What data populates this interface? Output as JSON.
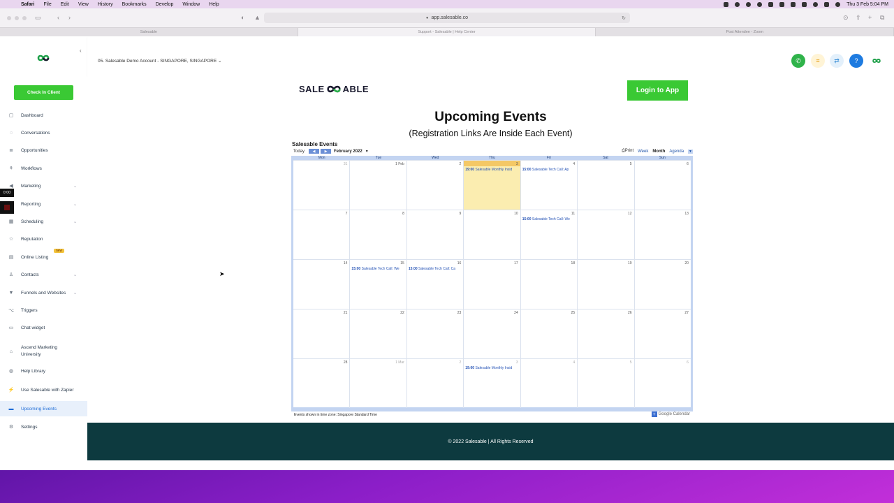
{
  "menubar": {
    "app": "Safari",
    "items": [
      "File",
      "Edit",
      "View",
      "History",
      "Bookmarks",
      "Develop",
      "Window",
      "Help"
    ],
    "clock": "Thu 3 Feb  5:04 PM"
  },
  "browser": {
    "url": "app.salesable.co",
    "tabs": [
      "Salesable",
      "Support - Salesable | Help Center",
      "Post Attendee - Zoom"
    ]
  },
  "sidebar": {
    "checkin_label": "Check In Client",
    "new_badge": "new",
    "recording_time": "0:00",
    "items": [
      {
        "label": "Dashboard",
        "icon": "dashboard-icon",
        "chev": false
      },
      {
        "label": "Conversations",
        "icon": "chat-bubble-icon",
        "chev": false
      },
      {
        "label": "Opportunities",
        "icon": "list-icon",
        "chev": false
      },
      {
        "label": "Workflows",
        "icon": "workflow-icon",
        "chev": false
      },
      {
        "label": "Marketing",
        "icon": "megaphone-icon",
        "chev": true
      },
      {
        "label": "Reporting",
        "icon": "chart-icon",
        "chev": true
      },
      {
        "label": "Scheduling",
        "icon": "calendar-icon",
        "chev": true
      },
      {
        "label": "Reputation",
        "icon": "star-icon",
        "chev": false
      },
      {
        "label": "Online Listing",
        "icon": "listing-icon",
        "chev": false
      },
      {
        "label": "Contacts",
        "icon": "person-icon",
        "chev": true
      },
      {
        "label": "Funnels and Websites",
        "icon": "funnel-icon",
        "chev": true
      },
      {
        "label": "Triggers",
        "icon": "trigger-icon",
        "chev": false
      },
      {
        "label": "Chat widget",
        "icon": "chat-widget-icon",
        "chev": false
      },
      {
        "label": "Ascend Marketing University",
        "icon": "university-icon",
        "chev": false
      },
      {
        "label": "Help Library",
        "icon": "help-icon",
        "chev": false
      },
      {
        "label": "Use Salesable with Zapier",
        "icon": "plug-icon",
        "chev": false
      },
      {
        "label": "Upcoming Events",
        "icon": "events-icon",
        "chev": false
      },
      {
        "label": "Settings",
        "icon": "gear-icon",
        "chev": false
      }
    ]
  },
  "topbar": {
    "account": "05. Salesable Demo Account - SINGAPORE, SINGAPORE"
  },
  "page": {
    "brand_left": "SALE",
    "brand_right": "ABLE",
    "login_label": "Login to App",
    "title": "Upcoming Events",
    "subtitle": "(Registration Links Are Inside Each Event)"
  },
  "calendar": {
    "title": "Salesable Events",
    "today_label": "Today",
    "month_label": "February 2022",
    "views": {
      "print": "Print",
      "week": "Week",
      "month": "Month",
      "agenda": "Agenda"
    },
    "dow": [
      "Mon",
      "Tue",
      "Wed",
      "Thu",
      "Fri",
      "Sat",
      "Sun"
    ],
    "weeks": [
      [
        {
          "n": "31",
          "off": true
        },
        {
          "n": "1 Feb"
        },
        {
          "n": "2"
        },
        {
          "n": "3",
          "today": true,
          "ev": {
            "t": "19:00",
            "l": "Salesable Monthly Insid"
          }
        },
        {
          "n": "4",
          "ev": {
            "t": "15:00",
            "l": "Salesable Tech Call: Ap"
          }
        },
        {
          "n": "5"
        },
        {
          "n": "6"
        }
      ],
      [
        {
          "n": "7"
        },
        {
          "n": "8"
        },
        {
          "n": "9"
        },
        {
          "n": "10"
        },
        {
          "n": "11",
          "ev": {
            "t": "15:00",
            "l": "Salesable Tech Call: We"
          }
        },
        {
          "n": "12"
        },
        {
          "n": "13"
        }
      ],
      [
        {
          "n": "14"
        },
        {
          "n": "15",
          "ev": {
            "t": "15:00",
            "l": "Salesable Tech Call: We"
          }
        },
        {
          "n": "16",
          "ev": {
            "t": "15:00",
            "l": "Salesable Tech Call: Ca"
          }
        },
        {
          "n": "17"
        },
        {
          "n": "18"
        },
        {
          "n": "19"
        },
        {
          "n": "20"
        }
      ],
      [
        {
          "n": "21"
        },
        {
          "n": "22"
        },
        {
          "n": "23"
        },
        {
          "n": "24"
        },
        {
          "n": "25"
        },
        {
          "n": "26"
        },
        {
          "n": "27"
        }
      ],
      [
        {
          "n": "28"
        },
        {
          "n": "1 Mar",
          "off": true
        },
        {
          "n": "2",
          "off": true
        },
        {
          "n": "3",
          "off": true,
          "ev": {
            "t": "19:00",
            "l": "Salesable Monthly Insid"
          }
        },
        {
          "n": "4",
          "off": true
        },
        {
          "n": "5",
          "off": true
        },
        {
          "n": "6",
          "off": true
        }
      ]
    ],
    "footer_note": "Events shown in time zone: Singapore Standard Time",
    "gcal_label": "Google Calendar"
  },
  "footer": {
    "text": "© 2022 Salesable | All Rights Reserved"
  },
  "colors": {
    "accent_green": "#3ac934",
    "footer_bg": "#0d3a3f",
    "active_blue": "#1e6cd6"
  }
}
